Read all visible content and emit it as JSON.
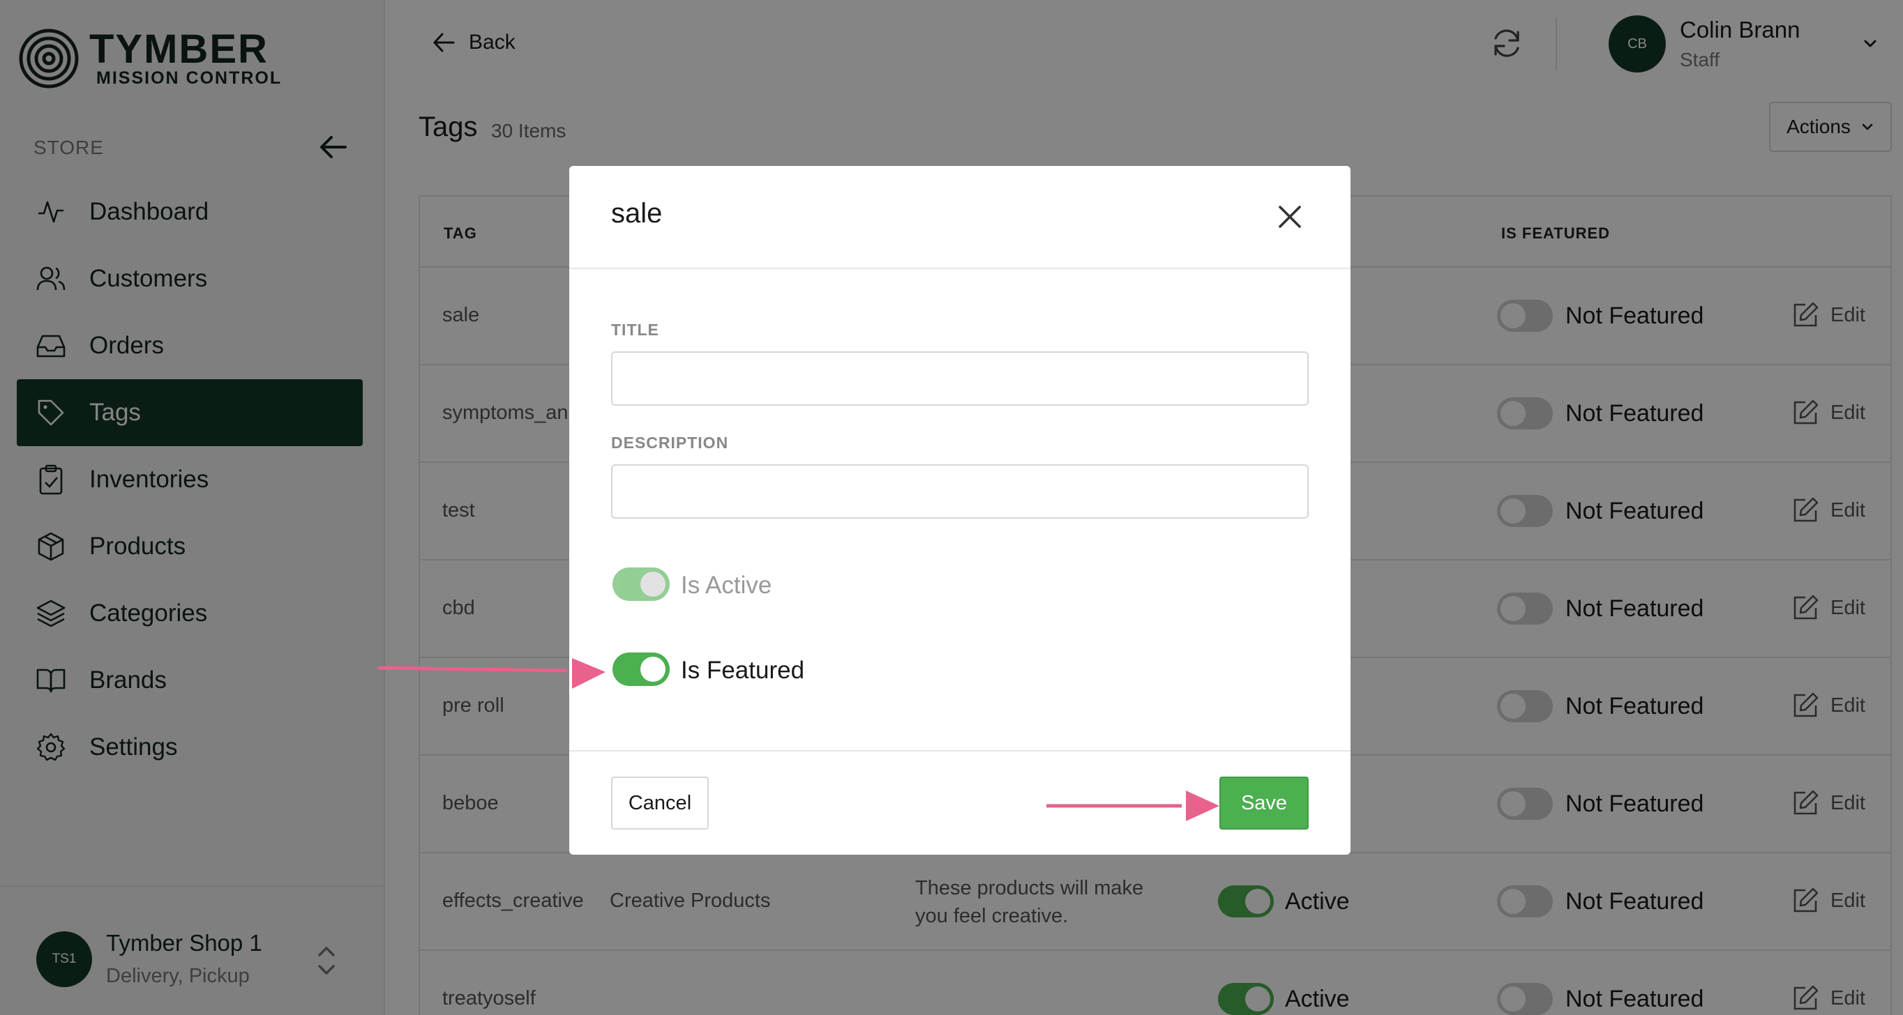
{
  "brand": {
    "title": "TYMBER",
    "subtitle": "MISSION CONTROL"
  },
  "sidebar": {
    "section_label": "STORE",
    "items": [
      {
        "label": "Dashboard",
        "icon": "activity-icon"
      },
      {
        "label": "Customers",
        "icon": "users-icon"
      },
      {
        "label": "Orders",
        "icon": "inbox-icon"
      },
      {
        "label": "Tags",
        "icon": "tag-icon",
        "active": true
      },
      {
        "label": "Inventories",
        "icon": "clipboard-icon"
      },
      {
        "label": "Products",
        "icon": "box-icon"
      },
      {
        "label": "Categories",
        "icon": "layers-icon"
      },
      {
        "label": "Brands",
        "icon": "book-icon"
      },
      {
        "label": "Settings",
        "icon": "gear-icon"
      }
    ],
    "shop": {
      "initials": "TS1",
      "name": "Tymber Shop 1",
      "modes": "Delivery, Pickup"
    }
  },
  "header": {
    "back_label": "Back",
    "user": {
      "initials": "CB",
      "name": "Colin Brann",
      "role": "Staff"
    }
  },
  "page": {
    "title": "Tags",
    "count": "30 Items",
    "actions_label": "Actions"
  },
  "table": {
    "columns": {
      "tag": "TAG",
      "is_featured": "IS FEATURED"
    },
    "edit_label": "Edit",
    "rows": [
      {
        "tag": "sale",
        "title": "",
        "description": "",
        "active_label": "",
        "featured_label": "Not Featured"
      },
      {
        "tag": "symptoms_an",
        "title": "",
        "description": "",
        "active_label": "",
        "featured_label": "Not Featured"
      },
      {
        "tag": "test",
        "title": "",
        "description": "",
        "active_label": "",
        "featured_label": "Not Featured"
      },
      {
        "tag": "cbd",
        "title": "",
        "description": "",
        "active_label": "",
        "featured_label": "Not Featured"
      },
      {
        "tag": "pre roll",
        "title": "",
        "description": "",
        "active_label": "",
        "featured_label": "Not Featured"
      },
      {
        "tag": "beboe",
        "title": "",
        "description": "",
        "active_label": "",
        "featured_label": "Not Featured"
      },
      {
        "tag": "effects_creative",
        "title": "Creative Products",
        "description": "These products will make you feel creative.",
        "active_label": "Active",
        "featured_label": "Not Featured"
      },
      {
        "tag": "treatyoself",
        "title": "",
        "description": "",
        "active_label": "Active",
        "featured_label": "Not Featured"
      }
    ]
  },
  "modal": {
    "title": "sale",
    "title_field_label": "TITLE",
    "title_value": "",
    "description_field_label": "DESCRIPTION",
    "description_value": "",
    "is_active_label": "Is Active",
    "is_active": true,
    "is_featured_label": "Is Featured",
    "is_featured": true,
    "cancel_label": "Cancel",
    "save_label": "Save"
  },
  "colors": {
    "brand_dark": "#15392a",
    "toggle_on": "#4caf50",
    "save_button": "#4caf50",
    "annotation_arrow": "#e8628c"
  }
}
